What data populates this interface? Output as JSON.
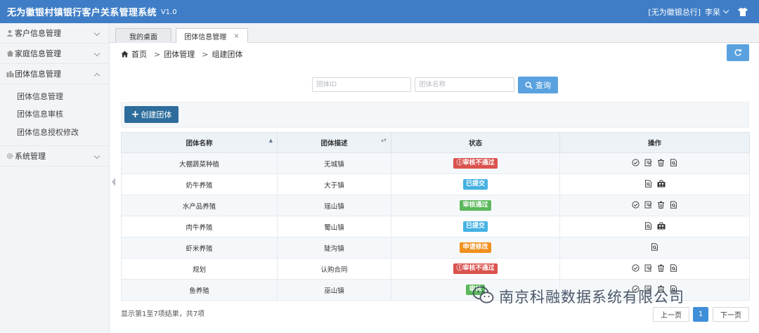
{
  "header": {
    "title": "无为徽银村镇银行客户关系管理系统",
    "version": "V1.0",
    "org": "[无为徽银总行]",
    "user": "李杲",
    "shirt_icon": "shirt-icon"
  },
  "sidebar": {
    "menus": [
      {
        "label": "客户信息管理",
        "icon": "user-icon"
      },
      {
        "label": "家庭信息管理",
        "icon": "home-icon"
      },
      {
        "label": "团体信息管理",
        "icon": "group-icon"
      }
    ],
    "submenu": [
      "团体信息管理",
      "团体信息审核",
      "团体信息授权修改"
    ],
    "system": {
      "label": "系统管理",
      "icon": "gear-icon"
    }
  },
  "tabs": [
    {
      "label": "我的桌面"
    },
    {
      "label": "团体信息管理",
      "close": "×"
    }
  ],
  "breadcrumb": {
    "home": "首页",
    "sep": ">",
    "level1": "团体管理",
    "level2": "组建团体"
  },
  "search": {
    "id_placeholder": "团体ID",
    "name_placeholder": "团体名称",
    "query_label": "查询"
  },
  "toolbar": {
    "create_label": "创建团体",
    "create_plus": "+"
  },
  "table": {
    "headers": [
      "团体名称",
      "团体描述",
      "状态",
      "操作"
    ],
    "sort_symbols": {
      "asc": "▲",
      "both": "▲▼"
    },
    "rows": [
      {
        "name": "大棚蔬菜种植",
        "desc": "无城镇",
        "status": "审核不通过",
        "status_prefix": "ⓘ",
        "status_type": "reject",
        "ops": [
          "check-circle-icon",
          "edit-icon",
          "trash-icon",
          "view-icon"
        ]
      },
      {
        "name": "奶牛养殖",
        "desc": "大于镇",
        "status": "已提交",
        "status_prefix": "",
        "status_type": "submitted",
        "ops": [
          "view-icon",
          "members-icon"
        ]
      },
      {
        "name": "水产品养殖",
        "desc": "瑶山镇",
        "status": "审核通过",
        "status_prefix": "",
        "status_type": "passed",
        "ops": [
          "check-circle-icon",
          "edit-icon",
          "trash-icon",
          "view-icon"
        ]
      },
      {
        "name": "肉牛养殖",
        "desc": "蜀山镇",
        "status": "已提交",
        "status_prefix": "",
        "status_type": "submitted",
        "ops": [
          "view-icon",
          "members-icon"
        ]
      },
      {
        "name": "虾米养殖",
        "desc": "陡沟镇",
        "status": "申请修改",
        "status_prefix": "",
        "status_type": "modify",
        "ops": [
          "view-icon"
        ]
      },
      {
        "name": "规划",
        "desc": "认购合同",
        "status": "审核不通过",
        "status_prefix": "ⓘ",
        "status_type": "reject",
        "ops": [
          "check-circle-icon",
          "edit-icon",
          "trash-icon",
          "view-icon"
        ]
      },
      {
        "name": "鱼养殖",
        "desc": "巫山镇",
        "status": "审核",
        "status_prefix": "",
        "status_type": "passed",
        "ops": [
          "check-circle-icon",
          "edit-icon",
          "trash-icon",
          "view-icon"
        ]
      }
    ]
  },
  "footer": {
    "summary": "显示第1至7项结果，共7项",
    "prev": "上一页",
    "current_page": "1",
    "next": "下一页"
  },
  "watermark": {
    "text": "南京科融数据系统有限公司",
    "icon": "wechat-icon"
  },
  "colors": {
    "header_bg": "#3f7ec7",
    "primary_button": "#5aa2df",
    "create_button": "#2d6d9c",
    "badge_reject": "#d9534f",
    "badge_submitted": "#45b1e3",
    "badge_passed": "#5cb85c",
    "badge_modify": "#f0901e",
    "page_current": "#3f8ed8"
  }
}
